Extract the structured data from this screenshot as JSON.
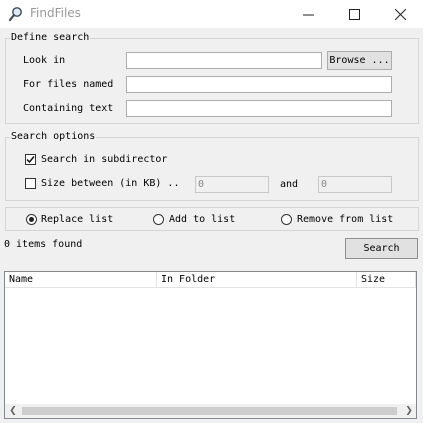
{
  "window": {
    "title": "FindFiles",
    "minimize_glyph": "—",
    "maximize_glyph": "☐",
    "close_glyph": "✕"
  },
  "define_search": {
    "group_label": "Define search",
    "look_in_label": "Look in",
    "look_in_value": "",
    "browse_label": "Browse ...",
    "files_named_label": "For files named",
    "files_named_value": "",
    "containing_text_label": "Containing text",
    "containing_text_value": ""
  },
  "search_options": {
    "group_label": "Search options",
    "subdirectories_label": "Search in subdirector",
    "subdirectories_checked": true,
    "size_between_label": "Size between (in KB) ..",
    "size_between_checked": false,
    "size_min": "0",
    "size_and_label": "and",
    "size_max": "0"
  },
  "result_mode": {
    "options": [
      {
        "label": "Replace list",
        "selected": true
      },
      {
        "label": "Add to list",
        "selected": false
      },
      {
        "label": "Remove from list",
        "selected": false
      }
    ]
  },
  "status": {
    "items_found": "0 items found"
  },
  "search_button_label": "Search",
  "results": {
    "columns": [
      "Name",
      "In Folder",
      "Size"
    ],
    "rows": []
  },
  "scrollbar": {
    "left_arrow": "❮",
    "right_arrow": "❯"
  }
}
